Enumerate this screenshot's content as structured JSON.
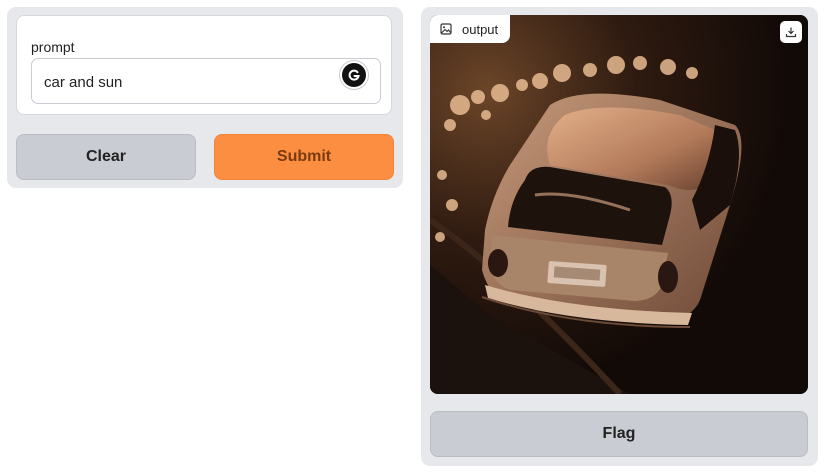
{
  "input": {
    "label": "prompt",
    "value": "car and sun"
  },
  "buttons": {
    "clear": "Clear",
    "submit": "Submit",
    "flag": "Flag"
  },
  "output": {
    "label": "output",
    "image_description": "sepia-toned photo of a hatchback car viewed from above and behind, parked on a road, with sunlit foliage at top-left",
    "icons": [
      "image-icon",
      "download-icon",
      "grammarly-icon"
    ]
  },
  "colors": {
    "panel_bg": "#e7e8ec",
    "submit_bg": "#fb8e40",
    "secondary_btn_bg": "#c9ccd3"
  }
}
